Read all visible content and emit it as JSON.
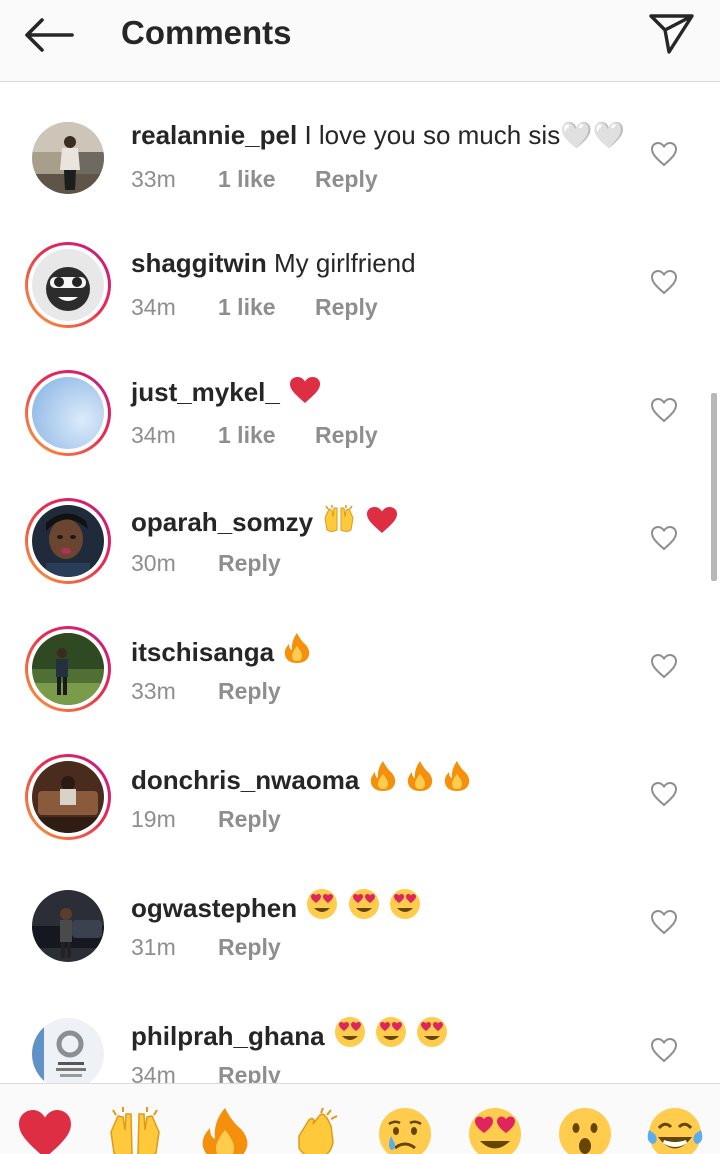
{
  "header": {
    "title": "Comments",
    "back_icon": "arrow-left-icon",
    "share_icon": "paper-plane-icon"
  },
  "comments": [
    {
      "username": "realannie_pel",
      "text": "I love you so much sis🤍🤍",
      "time": "33m",
      "likes": "1 like",
      "reply": "Reply",
      "story_ring": false
    },
    {
      "username": "shaggitwin",
      "text": "My girlfriend",
      "time": "34m",
      "likes": "1 like",
      "reply": "Reply",
      "story_ring": true
    },
    {
      "username": "just_mykel_",
      "text": "",
      "emojis": [
        "red-heart"
      ],
      "time": "34m",
      "likes": "1 like",
      "reply": "Reply",
      "story_ring": true
    },
    {
      "username": "oparah_somzy",
      "text": "",
      "emojis": [
        "raising-hands",
        "red-heart"
      ],
      "time": "30m",
      "likes": "",
      "reply": "Reply",
      "story_ring": true
    },
    {
      "username": "itschisanga",
      "text": "",
      "emojis": [
        "fire"
      ],
      "time": "33m",
      "likes": "",
      "reply": "Reply",
      "story_ring": true
    },
    {
      "username": "donchris_nwaoma",
      "text": "",
      "emojis": [
        "fire",
        "fire",
        "fire"
      ],
      "time": "19m",
      "likes": "",
      "reply": "Reply",
      "story_ring": true
    },
    {
      "username": "ogwastephen",
      "text": "",
      "emojis": [
        "heart-eyes",
        "heart-eyes",
        "heart-eyes"
      ],
      "time": "31m",
      "likes": "",
      "reply": "Reply",
      "story_ring": false
    },
    {
      "username": "philprah_ghana",
      "text": "",
      "emojis": [
        "heart-eyes",
        "heart-eyes",
        "heart-eyes"
      ],
      "time": "34m",
      "likes": "",
      "reply": "Reply",
      "story_ring": false
    }
  ],
  "quick_reactions": [
    "red-heart",
    "raising-hands",
    "fire",
    "clapping-hands",
    "crying-face",
    "heart-eyes",
    "surprised-face",
    "laughing-tears"
  ],
  "colors": {
    "text": "#262626",
    "meta": "#8e8e8e",
    "heart_red": "#dd2e44",
    "story_ring": "#ee2a4b"
  }
}
